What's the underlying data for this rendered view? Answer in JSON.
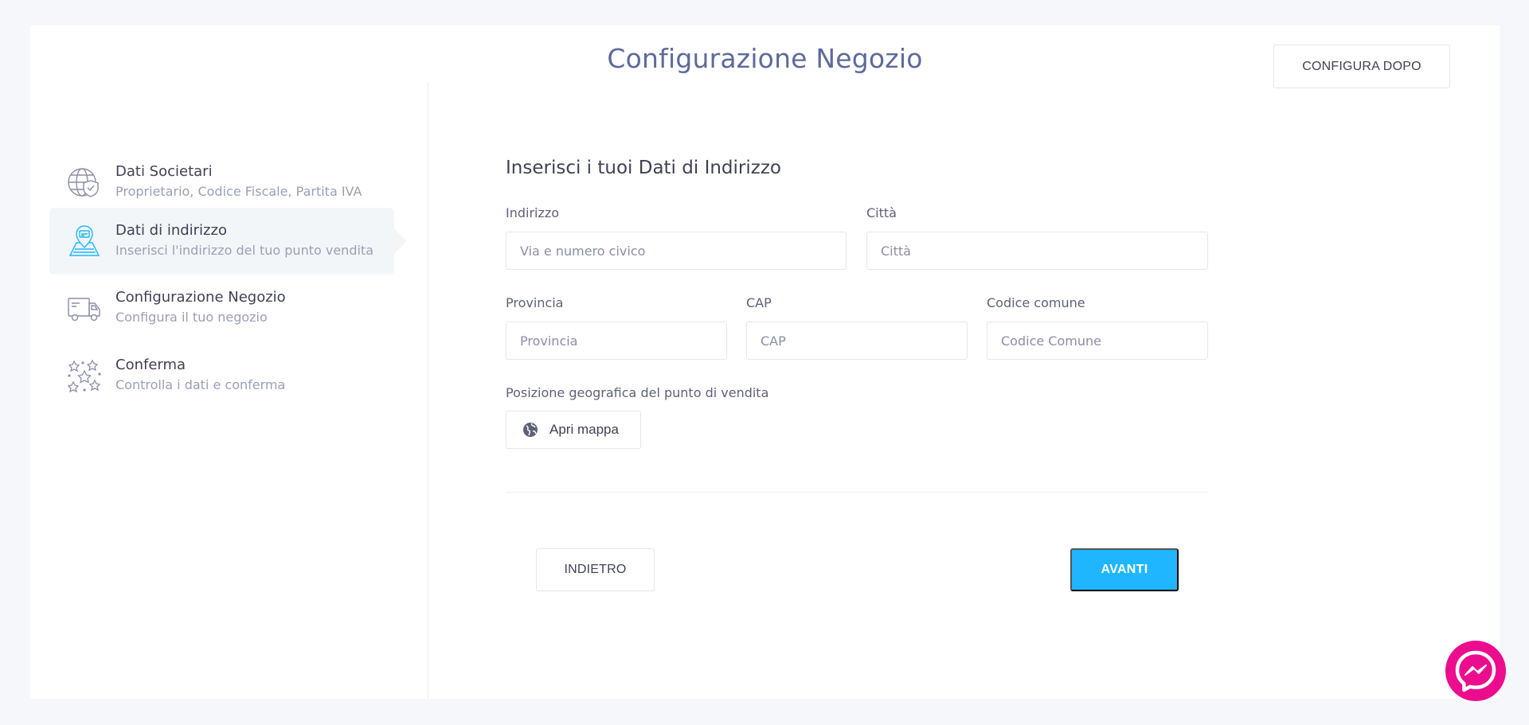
{
  "header": {
    "title": "Configurazione Negozio",
    "configure_later_label": "CONFIGURA DOPO"
  },
  "steps": [
    {
      "title": "Dati Societari",
      "description": "Proprietario, Codice Fiscale, Partita IVA",
      "icon": "globe-shield-icon",
      "active": false
    },
    {
      "title": "Dati di indirizzo",
      "description": "Inserisci l'indirizzo del tuo punto vendita",
      "icon": "map-location-icon",
      "active": true
    },
    {
      "title": "Configurazione Negozio",
      "description": "Configura il tuo negozio",
      "icon": "delivery-truck-icon",
      "active": false
    },
    {
      "title": "Conferma",
      "description": "Controlla i dati e conferma",
      "icon": "sparkles-icon",
      "active": false
    }
  ],
  "form": {
    "title": "Inserisci i tuoi Dati di Indirizzo",
    "fields": {
      "address": {
        "label": "Indirizzo",
        "placeholder": "Via e numero civico",
        "value": ""
      },
      "city": {
        "label": "Città",
        "placeholder": "Città",
        "value": ""
      },
      "province": {
        "label": "Provincia",
        "placeholder": "Provincia",
        "value": ""
      },
      "cap": {
        "label": "CAP",
        "placeholder": "CAP",
        "value": ""
      },
      "municipality_code": {
        "label": "Codice comune",
        "placeholder": "Codice Comune",
        "value": ""
      }
    },
    "geo_label": "Posizione geografica del punto di vendita",
    "map_button_label": "Apri mappa"
  },
  "footer": {
    "back_label": "INDIETRO",
    "next_label": "AVANTI"
  },
  "colors": {
    "accent": "#1fb6ff",
    "title": "#5e6a9b",
    "chat": "#ec0c8e"
  }
}
